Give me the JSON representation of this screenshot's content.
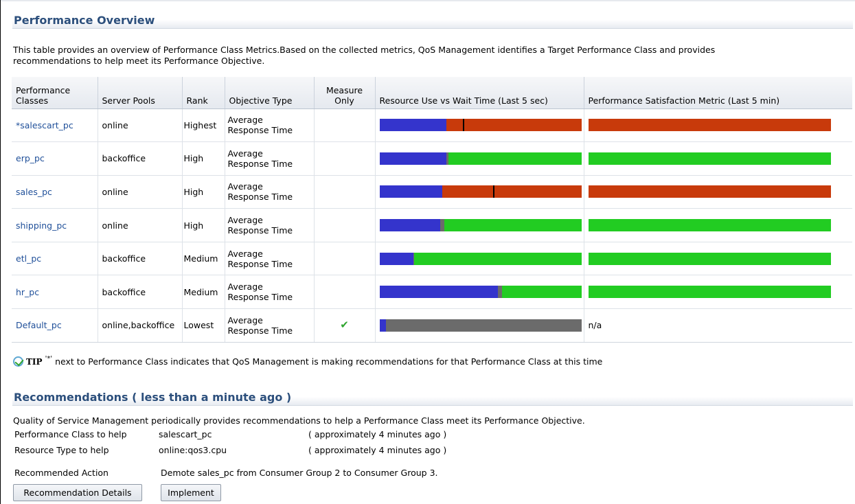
{
  "overview": {
    "title": "Performance Overview",
    "description_line1": "This table provides an overview of Performance Class Metrics.Based on the collected metrics, QoS Management identifies a Target Performance Class and provides",
    "description_line2": "recommendations to help meet its Performance Objective."
  },
  "table": {
    "headers": {
      "performance_classes": "Performance Classes",
      "server_pools": "Server Pools",
      "rank": "Rank",
      "objective_type": "Objective Type",
      "measure_only": "Measure Only",
      "resource_use": "Resource Use vs Wait Time (Last 5 sec)",
      "satisfaction": "Performance Satisfaction Metric (Last 5 min)"
    },
    "rows": [
      {
        "name": "*salescart_pc",
        "pools": "online",
        "rank": "Highest",
        "objective_line1": "Average",
        "objective_line2": "Response Time",
        "measure_only": "",
        "resource": {
          "use": 0.33,
          "gray": 0.0,
          "wait_color": "#c83a0b",
          "wait_marker": 0.41
        },
        "satisfaction": {
          "color": "#c83a0b",
          "text": ""
        }
      },
      {
        "name": "erp_pc",
        "pools": "backoffice",
        "rank": "High",
        "objective_line1": "Average",
        "objective_line2": "Response Time",
        "measure_only": "",
        "resource": {
          "use": 0.33,
          "gray": 0.01,
          "wait_color": "#22cc22",
          "wait_marker": null
        },
        "satisfaction": {
          "color": "#22cc22",
          "text": ""
        }
      },
      {
        "name": "sales_pc",
        "pools": "online",
        "rank": "High",
        "objective_line1": "Average",
        "objective_line2": "Response Time",
        "measure_only": "",
        "resource": {
          "use": 0.31,
          "gray": 0.0,
          "wait_color": "#c83a0b",
          "wait_marker": 0.56
        },
        "satisfaction": {
          "color": "#c83a0b",
          "text": ""
        }
      },
      {
        "name": "shipping_pc",
        "pools": "online",
        "rank": "High",
        "objective_line1": "Average",
        "objective_line2": "Response Time",
        "measure_only": "",
        "resource": {
          "use": 0.3,
          "gray": 0.02,
          "wait_color": "#22cc22",
          "wait_marker": null
        },
        "satisfaction": {
          "color": "#22cc22",
          "text": ""
        }
      },
      {
        "name": "etl_pc",
        "pools": "backoffice",
        "rank": "Medium",
        "objective_line1": "Average",
        "objective_line2": "Response Time",
        "measure_only": "",
        "resource": {
          "use": 0.165,
          "gray": 0.005,
          "wait_color": "#22cc22",
          "wait_marker": null
        },
        "satisfaction": {
          "color": "#22cc22",
          "text": ""
        }
      },
      {
        "name": "hr_pc",
        "pools": "backoffice",
        "rank": "Medium",
        "objective_line1": "Average",
        "objective_line2": "Response Time",
        "measure_only": "",
        "resource": {
          "use": 0.585,
          "gray": 0.02,
          "wait_color": "#22cc22",
          "wait_marker": null
        },
        "satisfaction": {
          "color": "#22cc22",
          "text": ""
        }
      },
      {
        "name": "Default_pc",
        "pools": "online,backoffice",
        "rank": "Lowest",
        "objective_line1": "Average",
        "objective_line2": "Response Time",
        "measure_only": "check",
        "resource": {
          "use": 0.03,
          "gray": 0.97,
          "wait_color": "#6b6b6b",
          "wait_marker": null
        },
        "satisfaction": {
          "color": "",
          "text": "n/a"
        }
      }
    ]
  },
  "tip": {
    "label": "TIP",
    "mark": "'*'",
    "text": "next to Performance Class indicates that QoS Management is making recommendations for that Performance Class at this time"
  },
  "recommendations": {
    "title": "Recommendations ( less than a minute ago )",
    "description": "Quality of Service Management periodically provides recommendations to help a Performance Class meet its Performance Objective.",
    "class_label": "Performance Class to help",
    "class_value": "salescart_pc",
    "class_time": "( approximately 4 minutes ago )",
    "resource_label": "Resource Type to help",
    "resource_value": "online:qos3.cpu",
    "resource_time": "( approximately 4 minutes ago )",
    "action_label": "Recommended Action",
    "action_value": "Demote sales_pc from Consumer Group 2 to Consumer Group 3.",
    "details_button": "Recommendation Details",
    "implement_button": "Implement"
  },
  "colors": {
    "use": "#3434cc",
    "gray": "#6b6b6b",
    "heading": "#2c4f7c",
    "link": "#1f4f99"
  }
}
